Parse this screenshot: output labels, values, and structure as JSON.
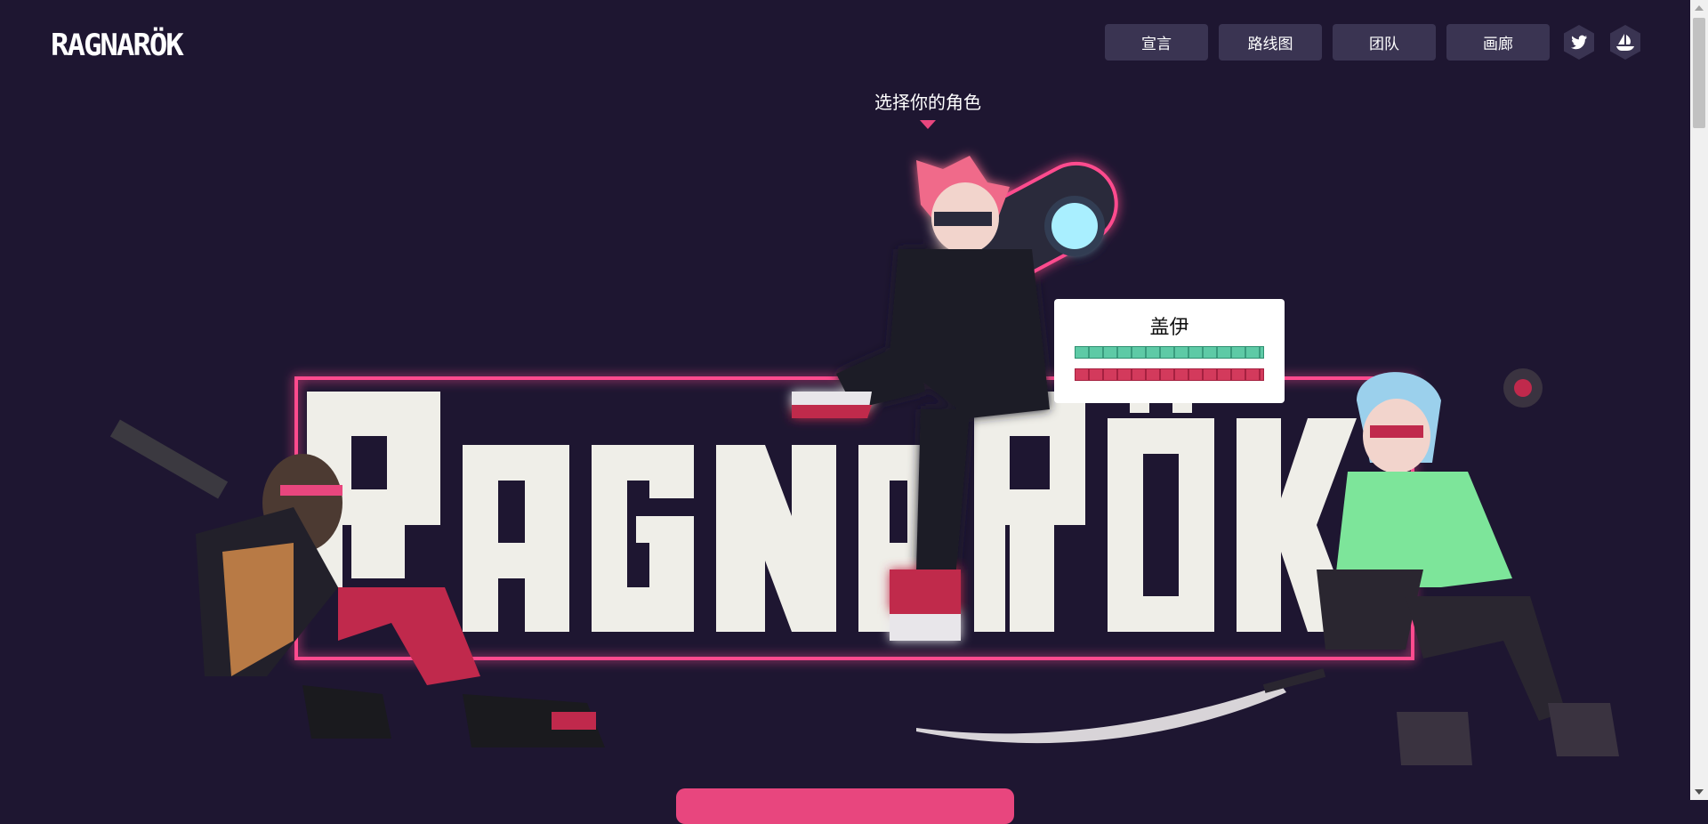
{
  "header": {
    "logo_text": "RAGNARÖK",
    "nav": [
      {
        "label": "宣言"
      },
      {
        "label": "路线图"
      },
      {
        "label": "团队"
      },
      {
        "label": "画廊"
      }
    ],
    "social": [
      {
        "icon": "twitter-icon"
      },
      {
        "icon": "opensea-icon"
      }
    ]
  },
  "hero": {
    "prompt": "选择你的角色",
    "big_logo_text": "RAGNARÖK"
  },
  "tooltip": {
    "name": "盖伊",
    "stats": [
      {
        "color": "#5ecaa6",
        "fraction": 1.0
      },
      {
        "color": "#d33a5c",
        "fraction": 1.0
      }
    ]
  },
  "colors": {
    "background": "#1e1631",
    "accent": "#e8467e",
    "nav_button": "#3a3452"
  }
}
